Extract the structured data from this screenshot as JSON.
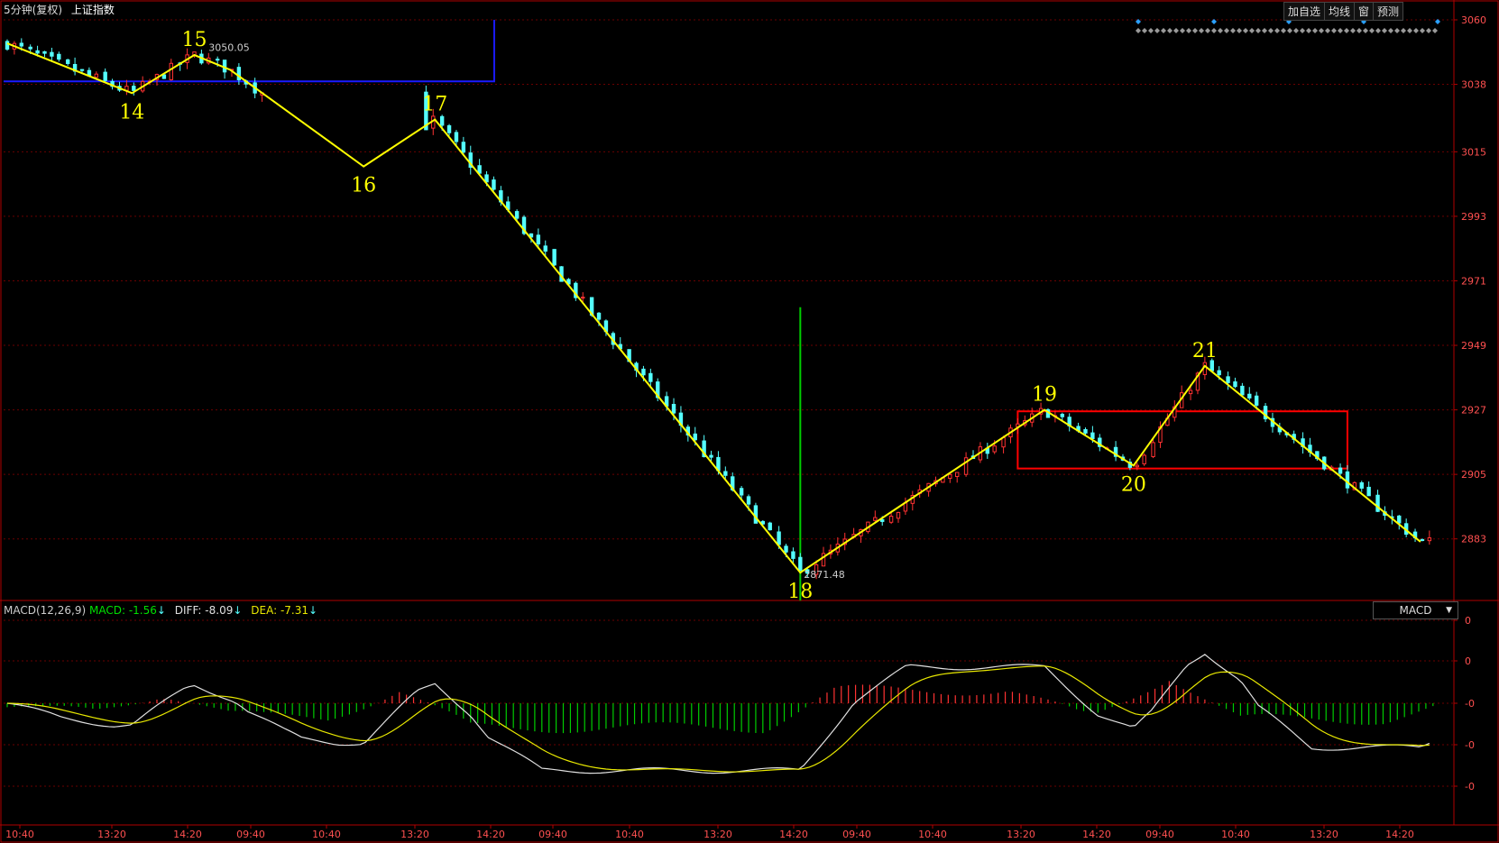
{
  "header": {
    "period": "5分钟(复权)",
    "symbol": "上证指数"
  },
  "toolbar": [
    {
      "name": "add-watchlist-button",
      "label": "加自选"
    },
    {
      "name": "ma-line-button",
      "label": "均线"
    },
    {
      "name": "window-button",
      "label": "窗"
    },
    {
      "name": "forecast-button",
      "label": "预测"
    }
  ],
  "colors": {
    "up": "#ff3232",
    "down": "#54ffff",
    "wave": "#ffff00",
    "box_blue": "#1a1aff",
    "box_red": "#ff0000",
    "vline": "#00cc00",
    "diff": "#e0e0e0",
    "dea": "#e8e800",
    "axis": "#b00000",
    "grid": "#6a0000",
    "text_axis": "#ff5050"
  },
  "macd_panel": {
    "name": "MACD(12,26,9)",
    "macd_label": "MACD:",
    "macd_value": "-1.56",
    "diff_label": "DIFF:",
    "diff_value": "-8.09",
    "dea_label": "DEA:",
    "dea_value": "-7.31",
    "arrow": "↓",
    "selector": "MACD",
    "selector_arrow": "▼",
    "y_ticks": [
      "0",
      "0",
      "-0",
      "-0",
      "-0"
    ]
  },
  "chart_data": [
    {
      "type": "candlestick",
      "name": "上证指数",
      "ylim": [
        2862,
        3060
      ],
      "y_ticks": [
        3060,
        3038,
        3015,
        2993,
        2971,
        2949,
        2927,
        2905,
        2883
      ],
      "x_ticks": [
        "10:40",
        "13:20",
        "14:20",
        "09:40",
        "10:40",
        "13:20",
        "14:20",
        "09:40",
        "10:40",
        "13:20",
        "14:20",
        "09:40",
        "10:40",
        "13:20",
        "14:20",
        "09:40",
        "10:40",
        "13:20",
        "14:20"
      ],
      "annotations": {
        "high_label": {
          "text": "3050.05",
          "value": 3050.05
        },
        "low_label": {
          "text": "2871.48",
          "value": 2871.48
        }
      },
      "wave_points": [
        {
          "label": "",
          "x": 0,
          "y": 3052
        },
        {
          "label": "14",
          "x": 70,
          "y": 3035
        },
        {
          "label": "15",
          "x": 105,
          "y": 3048
        },
        {
          "label": "",
          "x": 125,
          "y": 3043
        },
        {
          "label": "16",
          "x": 200,
          "y": 3010
        },
        {
          "label": "17",
          "x": 240,
          "y": 3026
        },
        {
          "label": "18",
          "x": 445,
          "y": 2871.5
        },
        {
          "label": "19",
          "x": 582,
          "y": 2927
        },
        {
          "label": "20",
          "x": 632,
          "y": 2908
        },
        {
          "label": "21",
          "x": 672,
          "y": 2942
        },
        {
          "label": "",
          "x": 793,
          "y": 2882
        }
      ]
    },
    {
      "type": "bar",
      "name": "MACD"
    }
  ]
}
